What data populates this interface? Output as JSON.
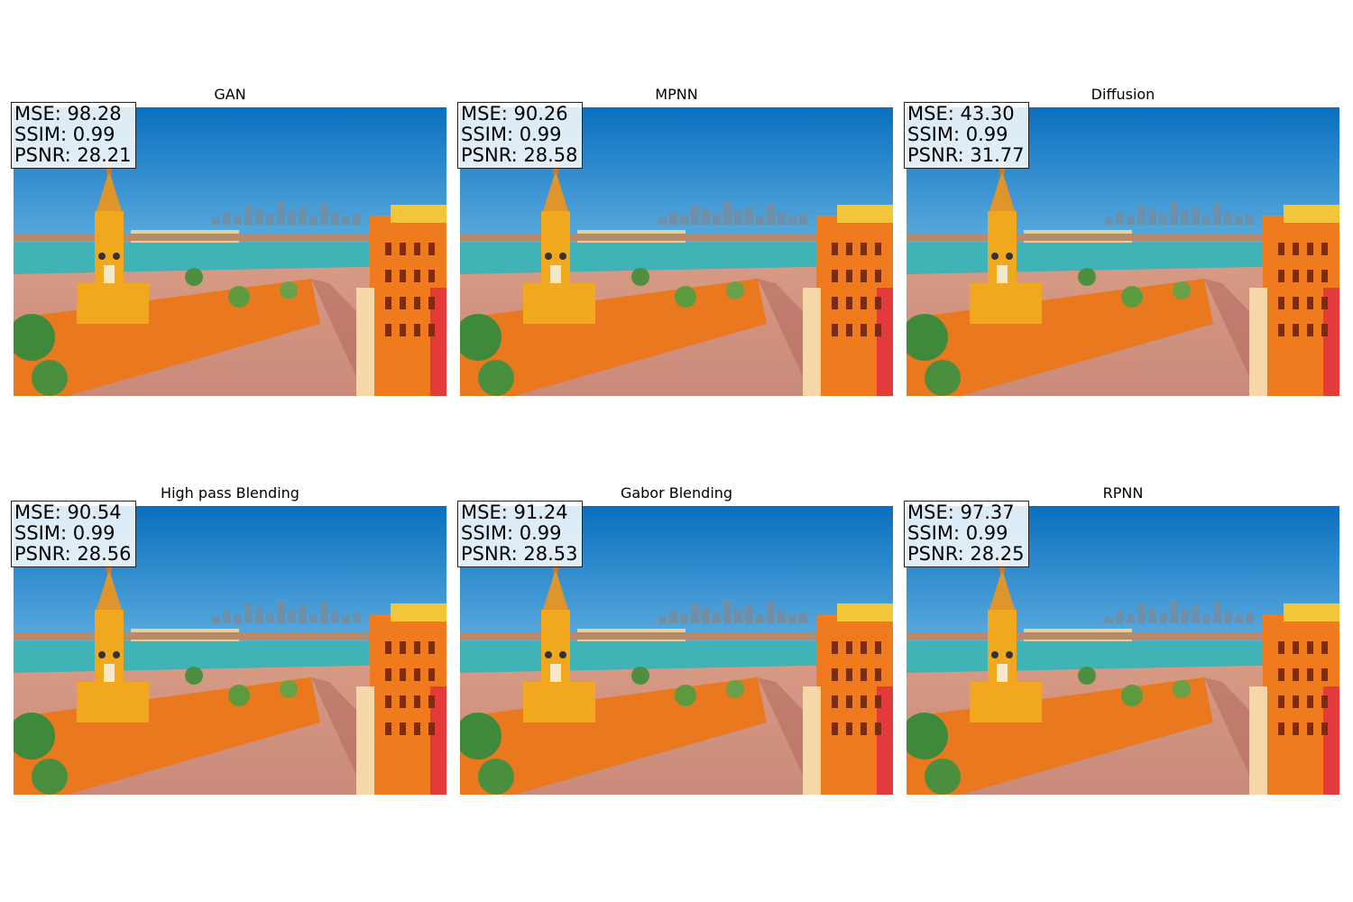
{
  "panels": [
    {
      "title": "GAN",
      "mse": "MSE: 98.28",
      "ssim": "SSIM: 0.99",
      "psnr": "PSNR: 28.21"
    },
    {
      "title": "MPNN",
      "mse": "MSE: 90.26",
      "ssim": "SSIM: 0.99",
      "psnr": "PSNR: 28.58"
    },
    {
      "title": "Diffusion",
      "mse": "MSE: 43.30",
      "ssim": "SSIM: 0.99",
      "psnr": "PSNR: 31.77"
    },
    {
      "title": "High pass Blending",
      "mse": "MSE: 90.54",
      "ssim": "SSIM: 0.99",
      "psnr": "PSNR: 28.56"
    },
    {
      "title": "Gabor Blending",
      "mse": "MSE: 91.24",
      "ssim": "SSIM: 0.99",
      "psnr": "PSNR: 28.53"
    },
    {
      "title": "RPNN",
      "mse": "MSE: 97.37",
      "ssim": "SSIM: 0.99",
      "psnr": "PSNR: 28.25"
    }
  ],
  "colors": {
    "sky_top": "#0a6fbf",
    "sky_mid": "#58a9dc",
    "sky_low": "#dcebf2",
    "wall": "#e9781f",
    "tower": "#f2a81e",
    "plaza": "#c98a7a",
    "water": "#3fb3b6"
  }
}
